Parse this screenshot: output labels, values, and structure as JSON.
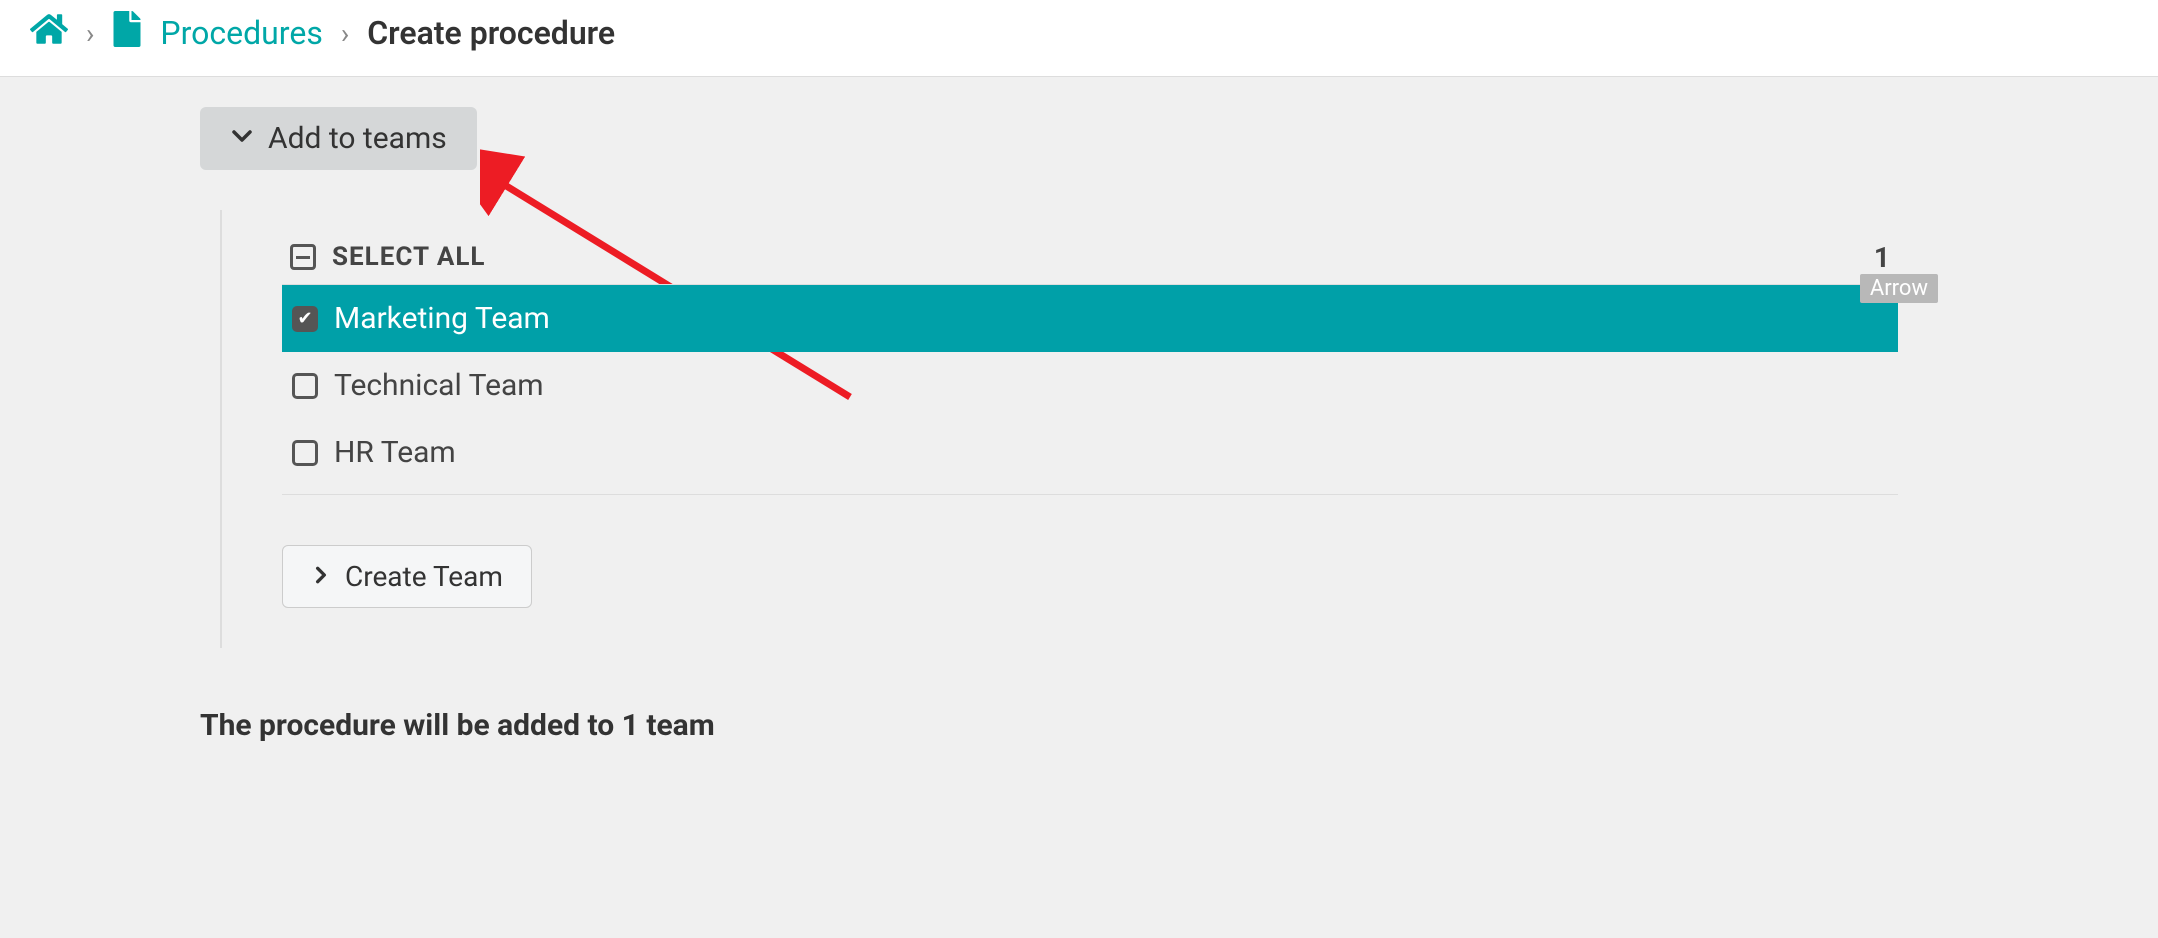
{
  "breadcrumb": {
    "procedures_label": "Procedures",
    "current_label": "Create procedure"
  },
  "collapse": {
    "label": "Add to teams"
  },
  "select_all": {
    "label": "SELECT ALL",
    "count": "1"
  },
  "arrow_tag": "Arrow",
  "teams": [
    {
      "label": "Marketing Team",
      "selected": true
    },
    {
      "label": "Technical Team",
      "selected": false
    },
    {
      "label": "HR Team",
      "selected": false
    }
  ],
  "create_team": {
    "label": "Create Team"
  },
  "summary": {
    "text": "The procedure will be added to 1 team"
  }
}
